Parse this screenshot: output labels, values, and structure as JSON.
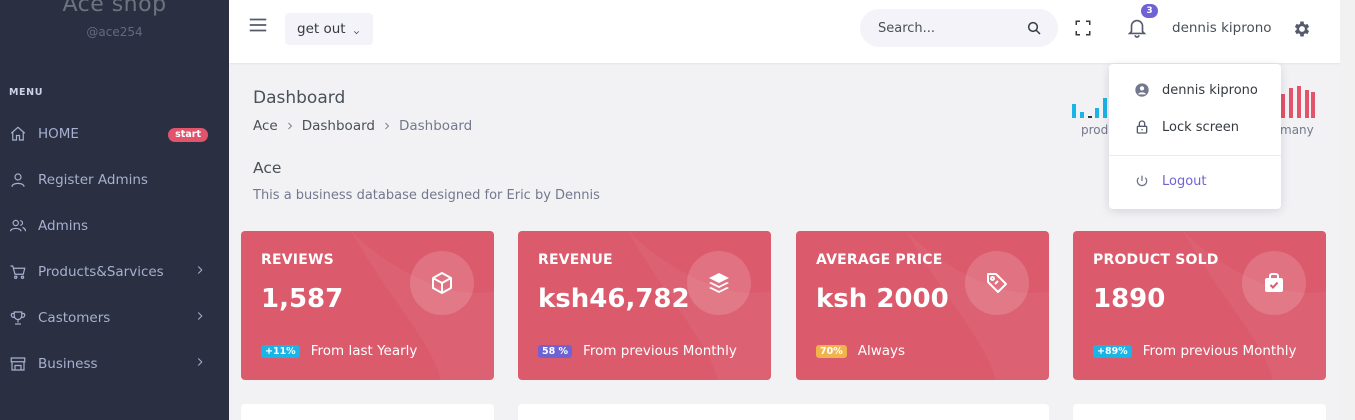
{
  "brand": {
    "name": "Ace shop",
    "handle": "@ace254"
  },
  "sidebar": {
    "menu_title": "MENU",
    "items": [
      {
        "label": "HOME",
        "icon": "home-icon",
        "badge": "start"
      },
      {
        "label": "Register Admins",
        "icon": "user-icon"
      },
      {
        "label": "Admins",
        "icon": "users-icon"
      },
      {
        "label": "Products&Sarvices",
        "icon": "cart-icon",
        "has_children": true
      },
      {
        "label": "Castomers",
        "icon": "trophy-icon",
        "has_children": true
      },
      {
        "label": "Business",
        "icon": "store-icon",
        "has_children": true
      }
    ]
  },
  "header": {
    "menu_button": "get out",
    "search_placeholder": "Search...",
    "notification_count": "3",
    "user_name": "dennis kiprono"
  },
  "page": {
    "title": "Dashboard",
    "breadcrumb": [
      "Ace",
      "Dashboard",
      "Dashboard"
    ],
    "section_title": "Ace",
    "section_desc": "This a business database designed for Eric by Dennis"
  },
  "minicharts": {
    "left_label": "prod",
    "right_label": "many"
  },
  "user_menu": {
    "items": [
      {
        "label": "dennis kiprono",
        "icon": "user-circle-icon"
      },
      {
        "label": "Lock screen",
        "icon": "lock-icon"
      }
    ],
    "logout": "Logout"
  },
  "cards": [
    {
      "title": "REVIEWS",
      "value": "1,587",
      "pill": "+11%",
      "pill_color": "#1ab4e6",
      "foot": "From last Yearly",
      "icon": "cube-icon"
    },
    {
      "title": "REVENUE",
      "value": "ksh46,782",
      "pill": "58 %",
      "pill_color": "#6f63d3",
      "foot": "From previous Monthly",
      "icon": "layers-icon"
    },
    {
      "title": "AVERAGE PRICE",
      "value": "ksh 2000",
      "pill": "70%",
      "pill_color": "#f1b44c",
      "foot": "Always",
      "icon": "tag-icon"
    },
    {
      "title": "PRODUCT SOLD",
      "value": "1890",
      "pill": "+89%",
      "pill_color": "#1ab4e6",
      "foot": "From previous Monthly",
      "icon": "briefcase-check-icon"
    }
  ],
  "colors": {
    "sidebar": "#2a3042",
    "card": "#db5a6c",
    "accent": "#6f63d3",
    "badge_start": "#e2546c"
  }
}
